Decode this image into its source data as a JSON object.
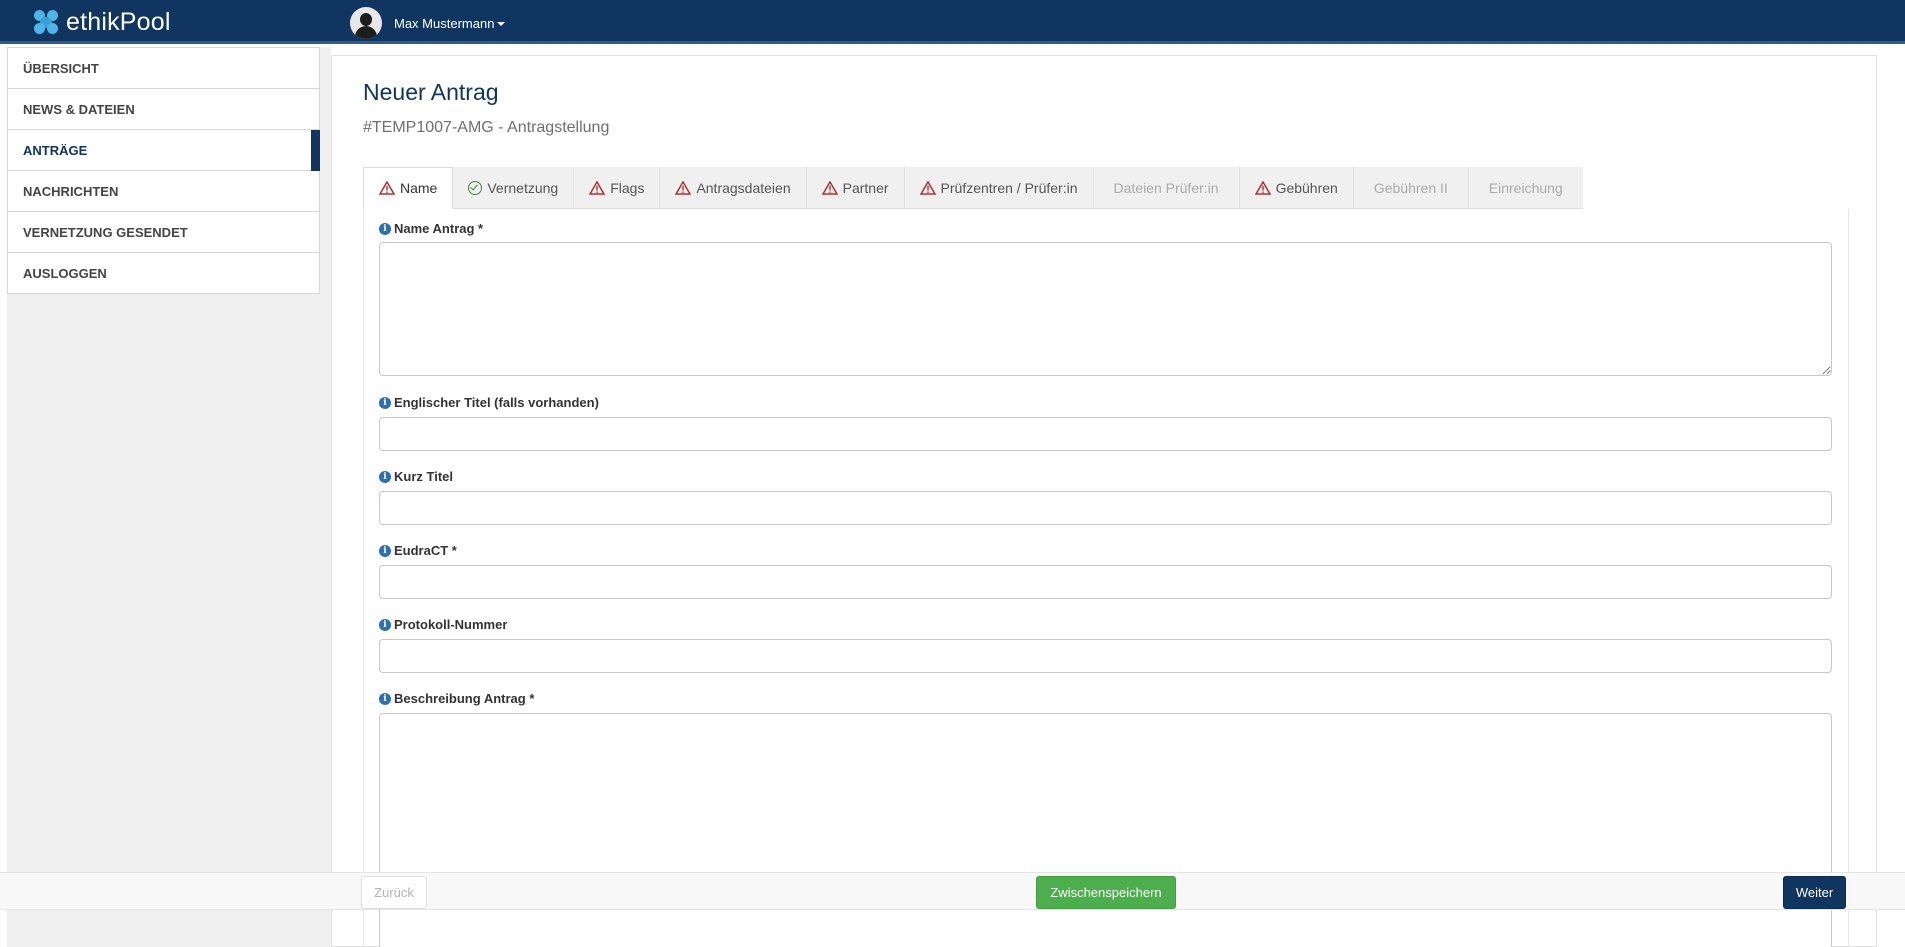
{
  "app": {
    "name": "ethikPool"
  },
  "user": {
    "name": "Max Mustermann"
  },
  "sidebar": {
    "items": [
      {
        "label": "ÜBERSICHT",
        "active": false
      },
      {
        "label": "NEWS & DATEIEN",
        "active": false
      },
      {
        "label": "ANTRÄGE",
        "active": true
      },
      {
        "label": "NACHRICHTEN",
        "active": false
      },
      {
        "label": "VERNETZUNG GESENDET",
        "active": false
      },
      {
        "label": "AUSLOGGEN",
        "active": false
      }
    ]
  },
  "page": {
    "title": "Neuer Antrag",
    "subtitle": "#TEMP1007-AMG - Antragstellung"
  },
  "tabs": [
    {
      "label": "Name",
      "status": "warning",
      "active": true
    },
    {
      "label": "Vernetzung",
      "status": "ok"
    },
    {
      "label": "Flags",
      "status": "warning"
    },
    {
      "label": "Antragsdateien",
      "status": "warning"
    },
    {
      "label": "Partner",
      "status": "warning"
    },
    {
      "label": "Prüfzentren / Prüfer:in",
      "status": "warning"
    },
    {
      "label": "Dateien Prüfer:in",
      "status": "disabled"
    },
    {
      "label": "Gebühren",
      "status": "warning"
    },
    {
      "label": "Gebühren II",
      "status": "disabled"
    },
    {
      "label": "Einreichung",
      "status": "disabled"
    }
  ],
  "form": {
    "name_antrag": {
      "label": "Name Antrag *",
      "value": ""
    },
    "englischer_titel": {
      "label": "Englischer Titel (falls vorhanden)",
      "value": ""
    },
    "kurz_titel": {
      "label": "Kurz Titel",
      "value": ""
    },
    "eudract": {
      "label": "EudraCT *",
      "value": ""
    },
    "protokoll_nummer": {
      "label": "Protokoll-Nummer",
      "value": ""
    },
    "beschreibung_antrag": {
      "label": "Beschreibung Antrag *",
      "value": ""
    }
  },
  "footer": {
    "back_label": "Zurück",
    "save_label": "Zwischenspeichern",
    "next_label": "Weiter"
  },
  "colors": {
    "brand": "#0f3560",
    "warning": "#b03030",
    "ok": "#3a8a3a",
    "save": "#4cae4c"
  }
}
